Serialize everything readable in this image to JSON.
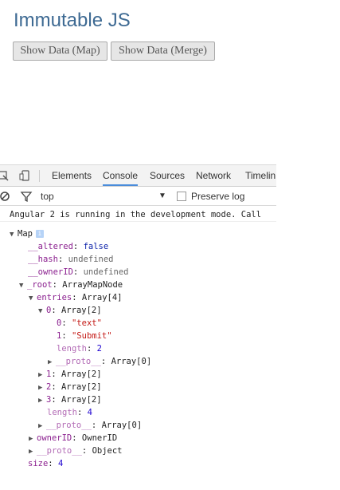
{
  "page": {
    "title": "Immutable JS",
    "buttons": {
      "map": "Show Data (Map)",
      "merge": "Show Data (Merge)"
    }
  },
  "devtools": {
    "tabs": [
      "Elements",
      "Console",
      "Sources",
      "Network",
      "Timelin"
    ],
    "active_tab": "Console",
    "filter": {
      "context": "top",
      "preserve_log": "Preserve log"
    },
    "message": "Angular 2 is running in the development mode. Call",
    "tree": {
      "root": "Map",
      "altered_key": "__altered",
      "altered_val": "false",
      "hash_key": "__hash",
      "hash_val": "undefined",
      "owner_key": "__ownerID",
      "owner_val": "undefined",
      "root_key": "_root",
      "root_val": "ArrayMapNode",
      "entries_key": "entries",
      "entries_val": "Array[4]",
      "e0_key": "0",
      "e0_val": "Array[2]",
      "e0_0_key": "0",
      "e0_0_val": "\"text\"",
      "e0_1_key": "1",
      "e0_1_val": "\"Submit\"",
      "e0_len_key": "length",
      "e0_len_val": "2",
      "e0_proto_key": "__proto__",
      "e0_proto_val": "Array[0]",
      "e1_key": "1",
      "e1_val": "Array[2]",
      "e2_key": "2",
      "e2_val": "Array[2]",
      "e3_key": "3",
      "e3_val": "Array[2]",
      "entries_len_key": "length",
      "entries_len_val": "4",
      "entries_proto_key": "__proto__",
      "entries_proto_val": "Array[0]",
      "ownerid_key": "ownerID",
      "ownerid_val": "OwnerID",
      "proto_key": "__proto__",
      "proto_val": "Object",
      "size_key": "size",
      "size_val": "4"
    }
  }
}
